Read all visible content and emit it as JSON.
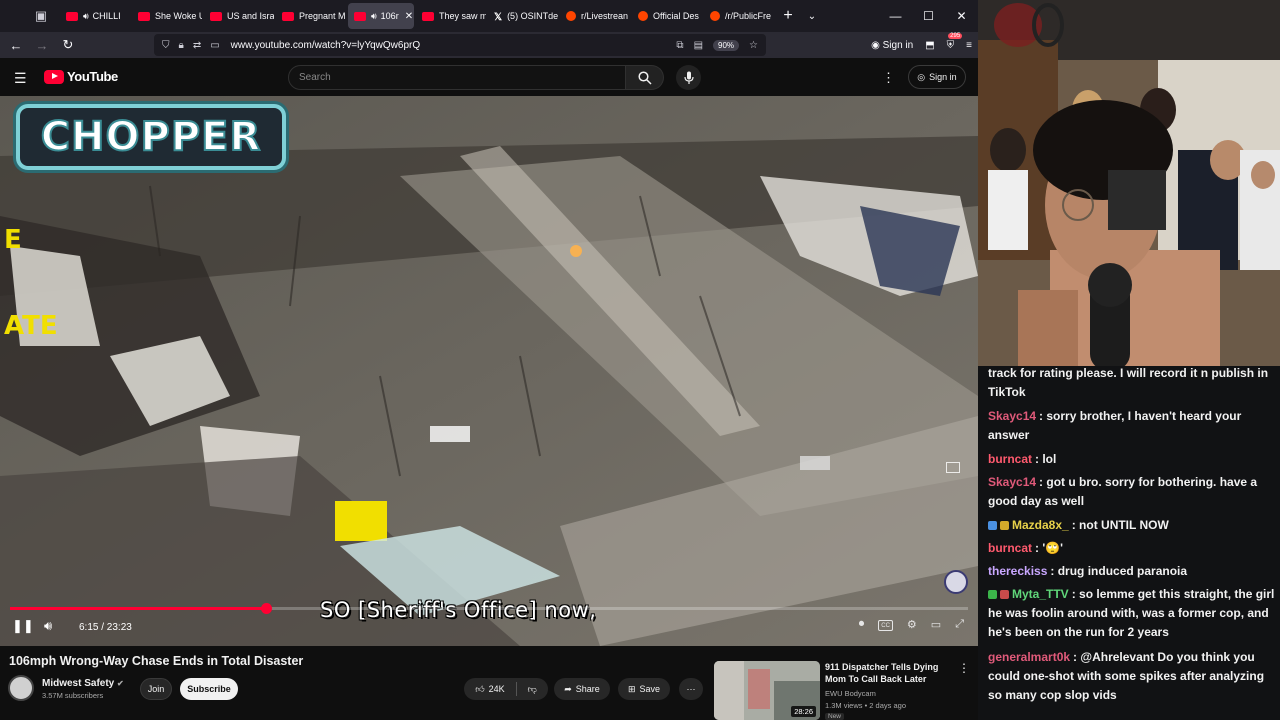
{
  "browser": {
    "tabs": [
      {
        "label": "CHILLI",
        "type": "yt",
        "speaker": true
      },
      {
        "label": "She Woke U",
        "type": "yt"
      },
      {
        "label": "US and Isra",
        "type": "yt"
      },
      {
        "label": "Pregnant M",
        "type": "yt"
      },
      {
        "label": "106r",
        "type": "yt",
        "speaker": true,
        "active": true
      },
      {
        "label": "They saw m",
        "type": "yt"
      },
      {
        "label": "(5) OSINTde",
        "type": "x"
      },
      {
        "label": "r/Livestrean",
        "type": "rd"
      },
      {
        "label": "Official Des",
        "type": "rd"
      },
      {
        "label": "/r/PublicFre",
        "type": "rd"
      }
    ],
    "url": "www.youtube.com/watch?v=lyYqwQw6prQ",
    "zoom": "90%",
    "signin": "Sign in",
    "ext_badge": "295"
  },
  "youtube": {
    "logo_text": "YouTube",
    "search_placeholder": "Search",
    "signin": "Sign in",
    "video": {
      "overlay_title": "CHOPPER",
      "caption": "SO [Sheriff's Office] now,",
      "time": "6:15 / 23:23",
      "progress": 0.2675
    },
    "title": "106mph Wrong-Way Chase Ends in Total Disaster",
    "channel": {
      "name": "Midwest Safety",
      "subscribers": "3.57M subscribers"
    },
    "buttons": {
      "join": "Join",
      "subscribe": "Subscribe",
      "likes": "24K",
      "share": "Share",
      "save": "Save"
    },
    "recommended": {
      "title": "911 Dispatcher Tells Dying Mom To Call Back Later",
      "channel": "EWU Bodycam",
      "meta": "1.3M views • 2 days ago",
      "badge": "New",
      "duration": "28:26"
    }
  },
  "chat": {
    "messages": [
      {
        "user": "",
        "text": "track for rating please. I will record it n publish in TikTok",
        "user_color": "#efefef"
      },
      {
        "user": "Skayc14",
        "text": ": sorry brother, I haven't heard your answer",
        "user_color": "#e05a7a"
      },
      {
        "user": "burncat",
        "text": ": lol",
        "user_color": "#ff5a6e"
      },
      {
        "user": "Skayc14",
        "text": ": got u bro. sorry for bothering. have a good day as well",
        "user_color": "#e05a7a"
      },
      {
        "user": "Mazda8x_",
        "text": ": not UNTIL NOW",
        "user_color": "#e8d24a"
      },
      {
        "user": "burncat",
        "text": ": '🙄'",
        "user_color": "#ff5a6e"
      },
      {
        "user": "thereckiss",
        "text": ": drug induced paranoia",
        "user_color": "#c9a7ff"
      },
      {
        "user": "Myta_TTV",
        "text": ": so lemme get this straight, the girl he was foolin around with, was a former cop, and he's been on the run for 2 years",
        "user_color": "#60d67a"
      },
      {
        "user": "generalmart0k",
        "text": ": @Ahrelevant Do you think you could one-shot with some spikes after analyzing so many cop slop vids",
        "user_color": "#e05a7a"
      }
    ]
  },
  "colors": {
    "accent": "#ff0033",
    "browser_bg": "#1c1b22",
    "page_bg": "#0f0f0f"
  }
}
